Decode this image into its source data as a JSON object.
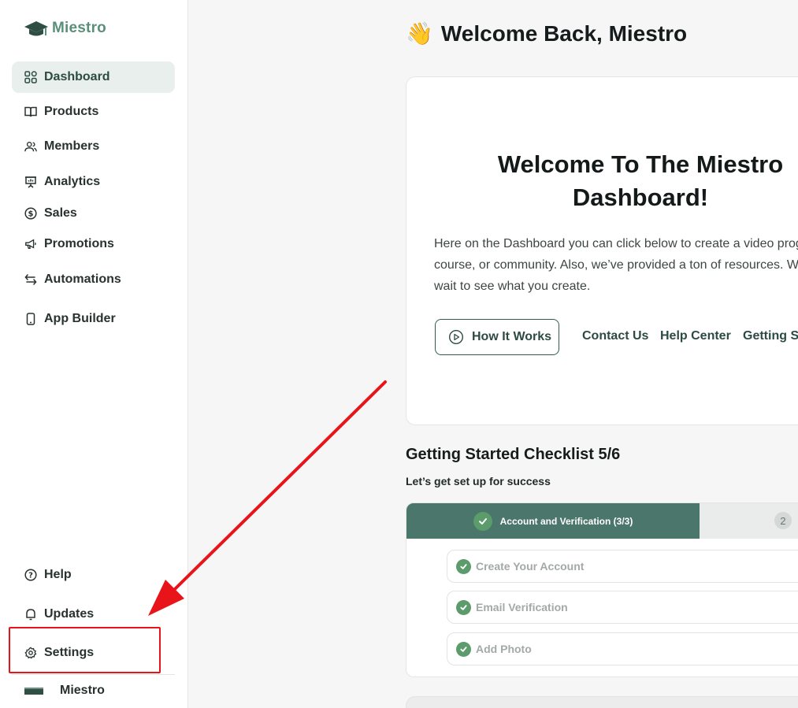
{
  "brand": {
    "name": "Miestro",
    "accent": "#4a766b",
    "logo_text_color": "#5a8f79"
  },
  "sidebar": {
    "items": [
      {
        "label": "Dashboard",
        "icon": "grid-icon",
        "active": true
      },
      {
        "label": "Products",
        "icon": "book-open-icon"
      },
      {
        "label": "Members",
        "icon": "users-icon"
      },
      {
        "label": "Analytics",
        "icon": "presentation-chart-icon"
      },
      {
        "label": "Sales",
        "icon": "dollar-circle-icon"
      },
      {
        "label": "Promotions",
        "icon": "megaphone-icon"
      },
      {
        "label": "Automations",
        "icon": "swap-arrows-icon"
      },
      {
        "label": "App Builder",
        "icon": "smartphone-icon"
      }
    ],
    "bottom_items": [
      {
        "label": "Help",
        "icon": "question-circle-icon"
      },
      {
        "label": "Updates",
        "icon": "bell-icon"
      },
      {
        "label": "Settings",
        "icon": "gear-icon"
      }
    ],
    "account": {
      "label": "Miestro",
      "icon": "account-thumbnail"
    }
  },
  "header": {
    "wave": "👋",
    "title": "Welcome Back, Miestro"
  },
  "welcome_card": {
    "title": "Welcome To The Miestro Dashboard!",
    "body": "Here on the Dashboard you can click below to create a video program, course, or community. Also, we’ve provided a ton of resources. We can’t wait to see what you create.",
    "how_it_works": "How It Works",
    "links": [
      "Contact Us",
      "Help Center",
      "Getting Started"
    ]
  },
  "checklist": {
    "title": "Getting Started Checklist 5/6",
    "subtitle": "Let’s get set up for success",
    "active_step": "Account and Verification (3/3)",
    "next_step_number": "2",
    "tasks": [
      "Create Your Account",
      "Email Verification",
      "Add Photo"
    ]
  },
  "annotation": {
    "color": "#e8141a",
    "target": "Settings"
  }
}
